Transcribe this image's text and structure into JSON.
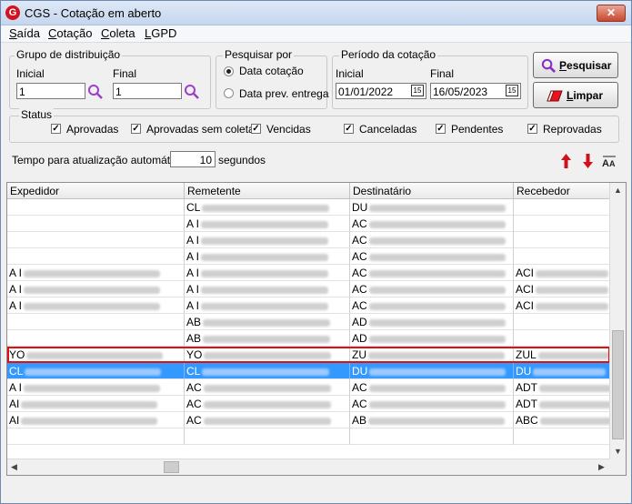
{
  "window": {
    "title": "CGS - Cotação em aberto",
    "icon": "cgs-logo-icon",
    "close": "✕"
  },
  "menu": [
    {
      "first": "S",
      "rest": "aída"
    },
    {
      "first": "C",
      "rest": "otação"
    },
    {
      "first": "C",
      "rest": "oleta"
    },
    {
      "first": "L",
      "rest": "GPD"
    }
  ],
  "grupo": {
    "legend": "Grupo de distribuição",
    "inicial_label": "Inicial",
    "inicial_value": "1",
    "final_label": "Final",
    "final_value": "1"
  },
  "pesquisar_por": {
    "legend": "Pesquisar por",
    "options": [
      "Data cotação",
      "Data prev. entrega"
    ],
    "selected": 0
  },
  "periodo": {
    "legend": "Período da cotação",
    "inicial_label": "Inicial",
    "inicial_value": "01/01/2022",
    "final_label": "Final",
    "final_value": "16/05/2023",
    "cal_glyph": "15"
  },
  "buttons": {
    "pesquisar": {
      "first": "P",
      "rest": "esquisar"
    },
    "limpar": {
      "first": "L",
      "rest": "impar"
    }
  },
  "status": {
    "legend": "Status",
    "items": [
      {
        "label": "Aprovadas",
        "checked": true
      },
      {
        "label": "Aprovadas sem coleta",
        "checked": true
      },
      {
        "label": "Vencidas",
        "checked": true
      },
      {
        "label": "Canceladas",
        "checked": true
      },
      {
        "label": "Pendentes",
        "checked": true
      },
      {
        "label": "Reprovadas",
        "checked": true
      }
    ]
  },
  "auto_update": {
    "label": "Tempo para atualização automática",
    "value": "10",
    "unit": "segundos"
  },
  "grid": {
    "columns": [
      "Expedidor",
      "Remetente",
      "Destinatário",
      "Recebedor"
    ],
    "rows": [
      [
        "",
        "CL",
        "DU",
        ""
      ],
      [
        "",
        "A I",
        "AC",
        ""
      ],
      [
        "",
        "A I",
        "AC",
        ""
      ],
      [
        "",
        "A I",
        "AC",
        ""
      ],
      [
        "A I",
        "A I",
        "AC",
        "ACI"
      ],
      [
        "A I",
        "A I",
        "AC",
        "ACI"
      ],
      [
        "A I",
        "A I",
        "AC",
        "ACI"
      ],
      [
        "",
        "AB",
        "AD",
        ""
      ],
      [
        "",
        "AB",
        "AD",
        ""
      ],
      [
        "YO",
        "YO",
        "ZU",
        "ZUL"
      ],
      [
        "CL",
        "CL",
        "DU",
        "DU"
      ],
      [
        "A I",
        "AC",
        "AC",
        "ADT"
      ],
      [
        "AI",
        "AC",
        "AC",
        "ADT"
      ],
      [
        "AI",
        "AC",
        "AB",
        "ABC"
      ],
      [
        "",
        "",
        "",
        ""
      ]
    ],
    "highlighted_row": 9,
    "selected_row": 10
  },
  "colors": {
    "selection": "#3399ff",
    "highlight_border": "#e01010",
    "arrow_red": "#d0101a"
  }
}
